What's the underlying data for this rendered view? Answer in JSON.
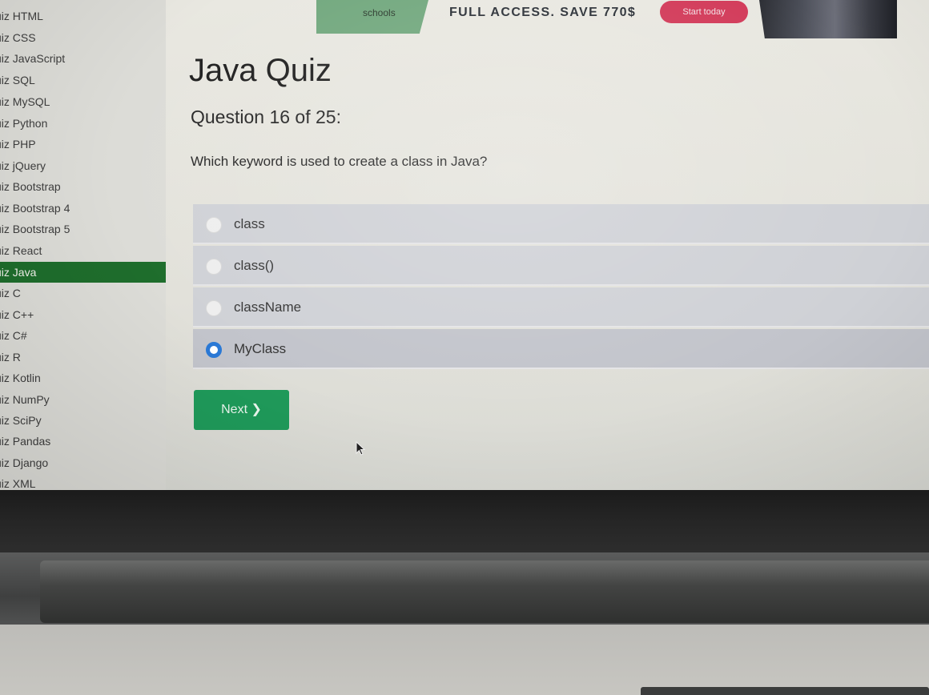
{
  "sidebar": {
    "items": [
      {
        "label": "uiz HTML",
        "active": false
      },
      {
        "label": "uiz CSS",
        "active": false
      },
      {
        "label": "uiz JavaScript",
        "active": false
      },
      {
        "label": "uiz SQL",
        "active": false
      },
      {
        "label": "uiz MySQL",
        "active": false
      },
      {
        "label": "uiz Python",
        "active": false
      },
      {
        "label": "uiz PHP",
        "active": false
      },
      {
        "label": "uiz jQuery",
        "active": false
      },
      {
        "label": "uiz Bootstrap",
        "active": false
      },
      {
        "label": "uiz Bootstrap 4",
        "active": false
      },
      {
        "label": "uiz Bootstrap 5",
        "active": false
      },
      {
        "label": "uiz React",
        "active": false
      },
      {
        "label": "uiz Java",
        "active": true
      },
      {
        "label": "uiz C",
        "active": false
      },
      {
        "label": "uiz C++",
        "active": false
      },
      {
        "label": "uiz C#",
        "active": false
      },
      {
        "label": "uiz R",
        "active": false
      },
      {
        "label": "uiz Kotlin",
        "active": false
      },
      {
        "label": "uiz NumPy",
        "active": false
      },
      {
        "label": "uiz SciPy",
        "active": false
      },
      {
        "label": "uiz Pandas",
        "active": false
      },
      {
        "label": "uiz Django",
        "active": false
      },
      {
        "label": "uiz XML",
        "active": false
      }
    ]
  },
  "ad": {
    "logo_text": "schools",
    "headline": "FULL ACCESS. SAVE 770$",
    "button_label": "Start today"
  },
  "quiz": {
    "title": "Java Quiz",
    "question_number": "Question 16 of 25:",
    "question": "Which keyword is used to create a class in Java?",
    "options": [
      {
        "label": "class",
        "selected": false
      },
      {
        "label": "class()",
        "selected": false
      },
      {
        "label": "className",
        "selected": false
      },
      {
        "label": "MyClass",
        "selected": true
      }
    ],
    "next_label": "Next ❯"
  },
  "colors": {
    "sidebar_active": "#1e6d2c",
    "next_button": "#1f9a5a",
    "ad_button": "#d23a59",
    "radio_checked": "#2a79d6"
  }
}
